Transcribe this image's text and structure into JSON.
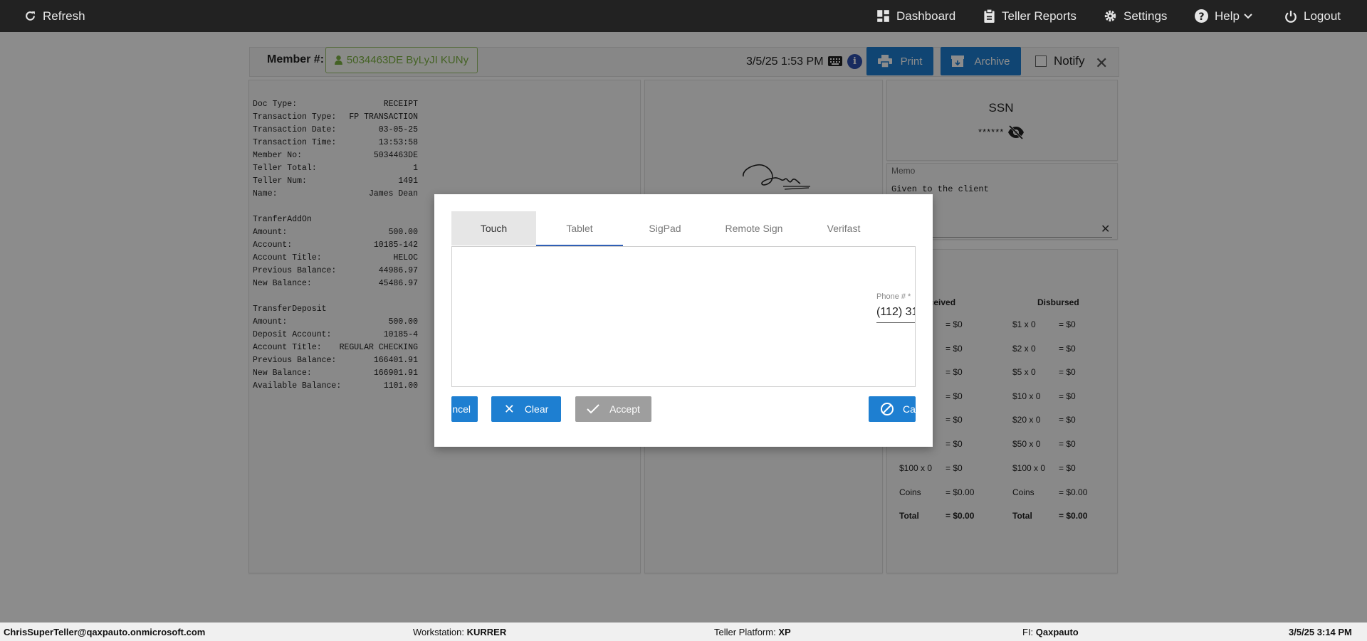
{
  "nav": {
    "refresh": "Refresh",
    "dashboard": "Dashboard",
    "teller_reports": "Teller Reports",
    "settings": "Settings",
    "help": "Help",
    "logout": "Logout"
  },
  "header": {
    "member_label": "Member #:",
    "member_value": "5034463DE ByLyJI KUNy",
    "datetime": "3/5/25 1:53 PM",
    "print": "Print",
    "archive": "Archive",
    "notify": "Notify"
  },
  "receipt": {
    "rows": [
      [
        "Doc Type:",
        "RECEIPT"
      ],
      [
        "Transaction Type:",
        "FP TRANSACTION"
      ],
      [
        "Transaction Date:",
        "03-05-25"
      ],
      [
        "Transaction Time:",
        "13:53:58"
      ],
      [
        "Member No:",
        "5034463DE"
      ],
      [
        "Teller Total:",
        "1"
      ],
      [
        "Teller Num:",
        "1491"
      ],
      [
        "Name:",
        "James Dean"
      ],
      [
        "",
        ""
      ],
      [
        "TranferAddOn",
        ""
      ],
      [
        "Amount:",
        "500.00"
      ],
      [
        "Account:",
        "10185-142"
      ],
      [
        "Account Title:",
        "HELOC"
      ],
      [
        "Previous Balance:",
        "44986.97"
      ],
      [
        "New Balance:",
        "45486.97"
      ],
      [
        "",
        ""
      ],
      [
        "TransferDeposit",
        ""
      ],
      [
        "Amount:",
        "500.00"
      ],
      [
        "Deposit Account:",
        "10185-4"
      ],
      [
        "Account Title:",
        "REGULAR CHECKING"
      ],
      [
        "Previous Balance:",
        "166401.91"
      ],
      [
        "New Balance:",
        "166901.91"
      ],
      [
        "Available Balance:",
        "1101.00"
      ]
    ]
  },
  "ssn": {
    "title": "SSN",
    "masked": "******"
  },
  "memo": {
    "label": "Memo",
    "text": "Given to the client"
  },
  "cash": {
    "received_header": "eceived",
    "disbursed_header": "Disbursed",
    "received_rows": [
      [
        "",
        "= $0"
      ],
      [
        "",
        "= $0"
      ],
      [
        "",
        "= $0"
      ],
      [
        "",
        "= $0"
      ],
      [
        "",
        "= $0"
      ],
      [
        "",
        "= $0"
      ],
      [
        "$100 x 0",
        "= $0"
      ],
      [
        "Coins",
        "= $0.00"
      ],
      [
        "Total",
        "= $0.00"
      ]
    ],
    "disbursed_rows": [
      [
        "$1 x 0",
        "= $0"
      ],
      [
        "$2 x 0",
        "= $0"
      ],
      [
        "$5 x 0",
        "= $0"
      ],
      [
        "$10 x 0",
        "= $0"
      ],
      [
        "$20 x 0",
        "= $0"
      ],
      [
        "$50 x 0",
        "= $0"
      ],
      [
        "$100 x 0",
        "= $0"
      ],
      [
        "Coins",
        "= $0.00"
      ],
      [
        "Total",
        "= $0.00"
      ]
    ]
  },
  "dialog": {
    "tabs": [
      "Touch",
      "Tablet",
      "SigPad",
      "Remote Sign",
      "Verifast"
    ],
    "phone_label": "Phone # *",
    "phone_value": "(112) 31",
    "cancel_left": "ncel",
    "clear": "Clear",
    "accept": "Accept",
    "cancel_right": "Ca"
  },
  "status": {
    "user": "ChrisSuperTeller@qaxpauto.onmicrosoft.com",
    "workstation_label": "Workstation: ",
    "workstation": "KURRER",
    "platform_label": "Teller Platform: ",
    "platform": "XP",
    "fi_label": "FI: ",
    "fi": "Qaxpauto",
    "datetime": "3/5/25 3:14 PM"
  }
}
